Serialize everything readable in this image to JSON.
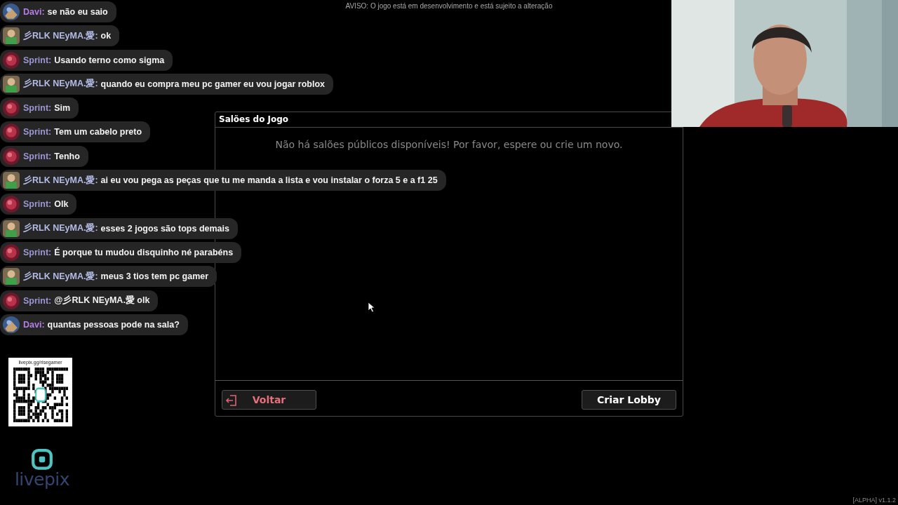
{
  "notice": "AVISO: O jogo está em desenvolvimento e está sujeito a alteração",
  "chat": [
    {
      "kind": "davi",
      "author": "Davi:",
      "color": "#b57ee6",
      "text": "se não eu saio"
    },
    {
      "kind": "neyma",
      "author": "彡RLK NEyMA.愛:",
      "color": "#b4bce6",
      "text": "ok"
    },
    {
      "kind": "sprint",
      "author": "Sprint:",
      "color": "#9c96d2",
      "text": "Usando terno como sigma"
    },
    {
      "kind": "neyma",
      "author": "彡RLK NEyMA.愛:",
      "color": "#b4bce6",
      "text": "quando eu compra meu pc gamer eu vou jogar roblox"
    },
    {
      "kind": "sprint",
      "author": "Sprint:",
      "color": "#9c96d2",
      "text": "Sim"
    },
    {
      "kind": "sprint",
      "author": "Sprint:",
      "color": "#9c96d2",
      "text": "Tem um cabelo preto"
    },
    {
      "kind": "sprint",
      "author": "Sprint:",
      "color": "#9c96d2",
      "text": "Tenho"
    },
    {
      "kind": "neyma",
      "author": "彡RLK NEyMA.愛:",
      "color": "#b4bce6",
      "text": "ai eu vou pega as peças que tu me manda a lista e vou instalar o forza 5 e a f1 25"
    },
    {
      "kind": "sprint",
      "author": "Sprint:",
      "color": "#9c96d2",
      "text": "Olk"
    },
    {
      "kind": "neyma",
      "author": "彡RLK NEyMA.愛:",
      "color": "#b4bce6",
      "text": "esses 2 jogos são tops demais"
    },
    {
      "kind": "sprint",
      "author": "Sprint:",
      "color": "#9c96d2",
      "text": "É porque tu mudou disquinho né parabéns"
    },
    {
      "kind": "neyma",
      "author": "彡RLK NEyMA.愛:",
      "color": "#b4bce6",
      "text": "meus 3 tios tem pc gamer"
    },
    {
      "kind": "sprint",
      "author": "Sprint:",
      "color": "#9c96d2",
      "text": "@彡RLK NEyMA.愛 olk"
    },
    {
      "kind": "davi",
      "author": "Davi:",
      "color": "#b57ee6",
      "text": "quantas pessoas pode na sala?"
    }
  ],
  "donation": {
    "url": "livepix.gg/risegamer",
    "brand": "livepix"
  },
  "dialog": {
    "title": "Salões do Jogo",
    "empty_message": "Não há salões públicos disponíveis! Por favor, espere ou crie um novo.",
    "buttons": [
      {
        "kind": "back",
        "label": "Voltar"
      },
      {
        "kind": "primary",
        "label": "Criar Lobby"
      }
    ]
  },
  "version": "[ALPHA] v1.1.2"
}
